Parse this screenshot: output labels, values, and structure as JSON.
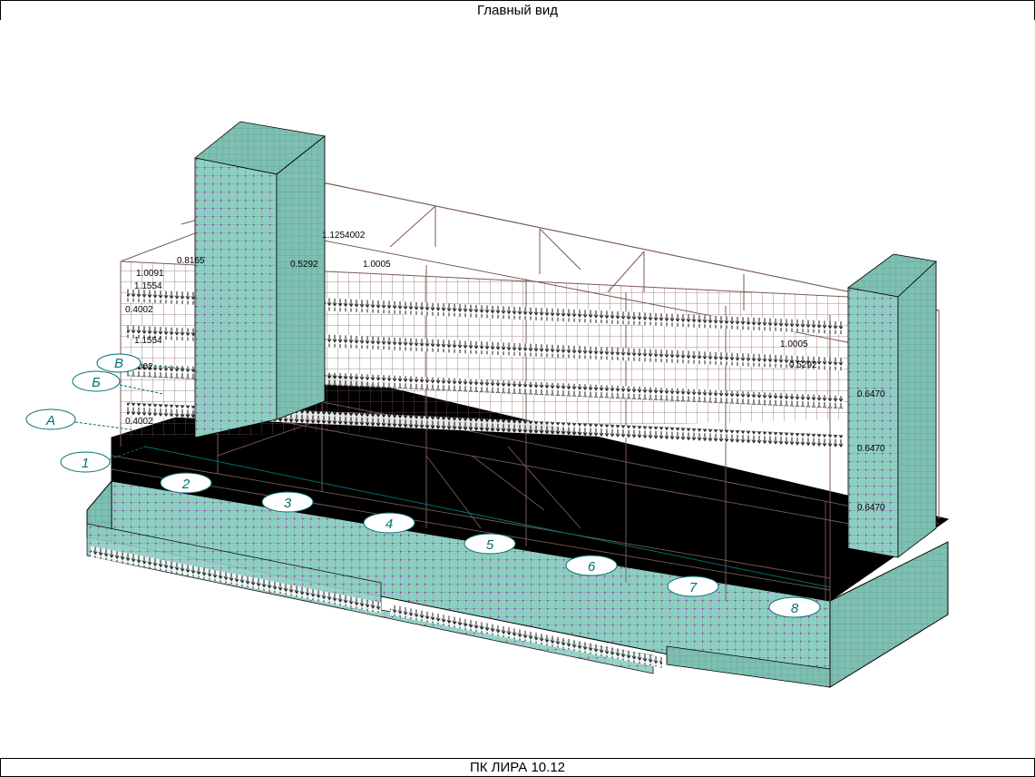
{
  "window": {
    "title": "Главный вид"
  },
  "status": {
    "text": "ПК ЛИРА 10.12"
  },
  "axes": {
    "letters": [
      "А",
      "Б",
      "В"
    ],
    "numbers": [
      "1",
      "2",
      "3",
      "4",
      "5",
      "6",
      "7",
      "8"
    ]
  },
  "load_labels": [
    "0.8165",
    "1.0091",
    "1.1554",
    "0.4002",
    "1.0005",
    "0.5292",
    "0.6470",
    "1.1254002"
  ],
  "colors": {
    "slab": "#000000",
    "shell": "#8fcfc2",
    "mesh": "#5aa294",
    "frame": "#7a5a55",
    "node": "#d000d0",
    "axis": "#006f6f"
  }
}
